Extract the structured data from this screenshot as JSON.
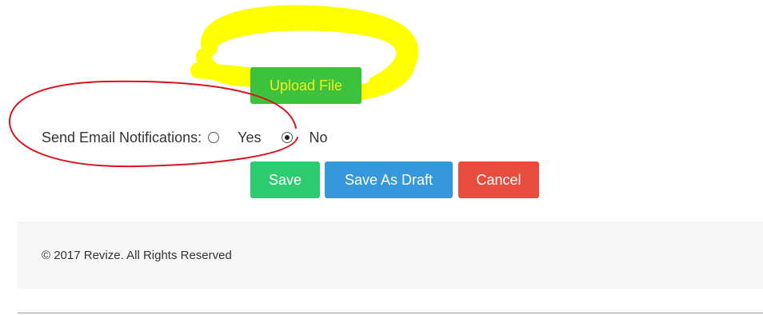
{
  "form": {
    "upload_label": "Upload File",
    "notify_label": "Send Email Notifications:",
    "options": [
      {
        "label": "Yes",
        "checked": false
      },
      {
        "label": "No",
        "checked": true
      }
    ],
    "actions": {
      "save_label": "Save",
      "draft_label": "Save As Draft",
      "cancel_label": "Cancel"
    }
  },
  "footer": {
    "copyright": "© 2017 Revize. All Rights Reserved"
  },
  "colors": {
    "upload_bg": "#3cc23c",
    "upload_text": "#f4f020",
    "save_bg": "#2ecc71",
    "draft_bg": "#3498db",
    "cancel_bg": "#e74c3c",
    "footer_bg": "#f7f7f7",
    "highlight_yellow": "#ffff00",
    "annotation_red": "#d9141e"
  }
}
